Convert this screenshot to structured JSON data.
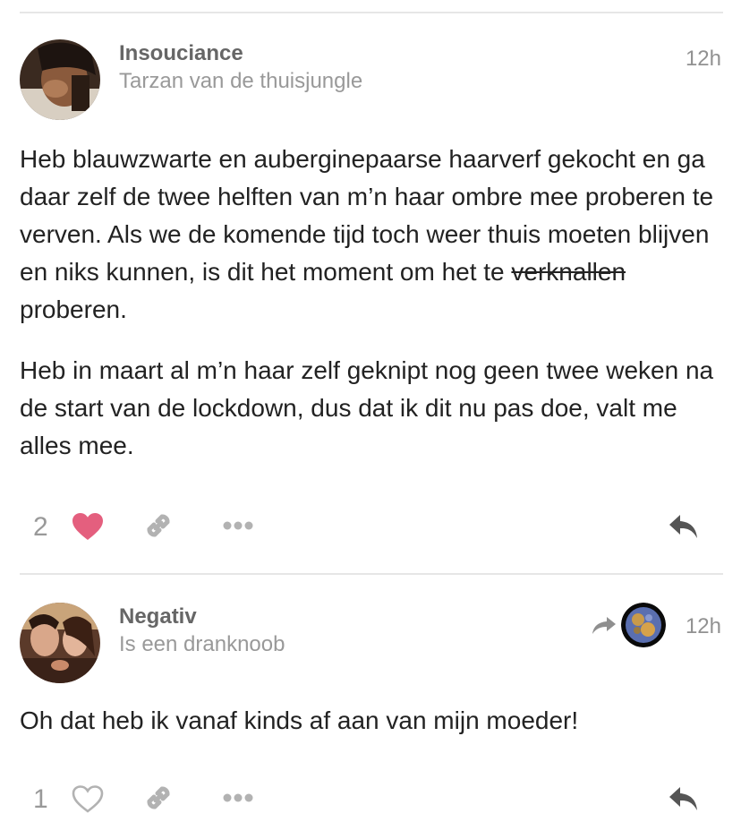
{
  "posts": [
    {
      "username": "Insouciance",
      "user_title": "Tarzan van de thuisjungle",
      "time": "12h",
      "paragraph1_before": "Heb blauwzwarte en auberginepaarse haarverf gekocht en ga daar zelf de twee helften van m’n haar ombre mee proberen te verven. Als we de komende tijd toch weer thuis moeten blijven en niks kunnen, is dit het moment om het te ",
      "paragraph1_strike": "verknallen",
      "paragraph1_after": " proberen.",
      "paragraph2": "Heb in maart al m’n haar zelf geknipt nog geen twee weken na de start van de lockdown, dus dat ik dit nu pas doe, valt me alles mee.",
      "like_count": "2",
      "liked": true
    },
    {
      "username": "Negativ",
      "user_title": "Is een dranknoob",
      "time": "12h",
      "body": "Oh dat heb ik vanaf kinds af aan van mijn moeder!",
      "like_count": "1",
      "liked": false
    }
  ],
  "colors": {
    "like_active": "#e45f7e",
    "icon_gray": "#b2b2b2",
    "reply_dark": "#555555"
  },
  "icons": [
    "heart-icon",
    "link-icon",
    "more-dots-icon",
    "reply-icon",
    "reply-to-arrow-icon"
  ]
}
